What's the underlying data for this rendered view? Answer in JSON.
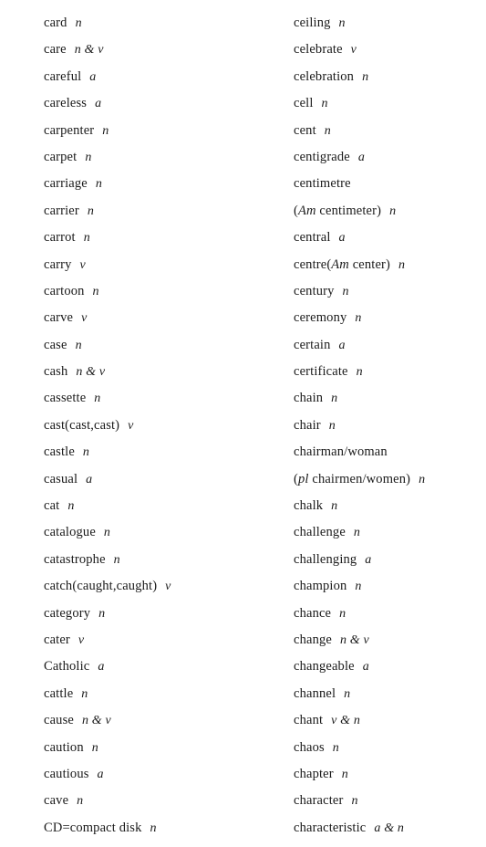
{
  "document": {
    "type": "vocabulary-word-list",
    "background_color": "#ffffff",
    "text_color": "#1a1a1a",
    "columns": 2,
    "line_count_per_column": 31
  },
  "left_column": {
    "name": "left-word-column",
    "entries": [
      {
        "word": "card",
        "pos": "n"
      },
      {
        "word": "care",
        "pos": "n & v"
      },
      {
        "word": "careful",
        "pos": "a"
      },
      {
        "word": "careless",
        "pos": "a"
      },
      {
        "word": "carpenter",
        "pos": "n"
      },
      {
        "word": "carpet",
        "pos": "n"
      },
      {
        "word": "carriage",
        "pos": "n"
      },
      {
        "word": "carrier",
        "pos": "n"
      },
      {
        "word": "carrot",
        "pos": "n"
      },
      {
        "word": "carry",
        "pos": "v"
      },
      {
        "word": "cartoon",
        "pos": "n"
      },
      {
        "word": "carve",
        "pos": "v"
      },
      {
        "word": "case",
        "pos": "n"
      },
      {
        "word": "cash",
        "pos": "n & v"
      },
      {
        "word": "cassette",
        "pos": "n"
      },
      {
        "word": "cast(cast,cast)",
        "pos": "v"
      },
      {
        "word": "castle",
        "pos": "n"
      },
      {
        "word": "casual",
        "pos": "a"
      },
      {
        "word": "cat",
        "pos": "n"
      },
      {
        "word": "catalogue",
        "pos": "n"
      },
      {
        "word": "catastrophe",
        "pos": "n"
      },
      {
        "word": "catch(caught,caught)",
        "pos": "v"
      },
      {
        "word": "category",
        "pos": "n"
      },
      {
        "word": "cater",
        "pos": "v"
      },
      {
        "word": "Catholic",
        "pos": "a"
      },
      {
        "word": "cattle",
        "pos": "n"
      },
      {
        "word": "cause",
        "pos": "n & v"
      },
      {
        "word": "caution",
        "pos": "n"
      },
      {
        "word": "cautious",
        "pos": "a"
      },
      {
        "word": "cave",
        "pos": "n"
      },
      {
        "word": "CD=compact disk",
        "pos": "n"
      }
    ]
  },
  "right_column": {
    "name": "right-word-column",
    "entries": [
      {
        "word": "ceiling",
        "pos": "n"
      },
      {
        "word": "celebrate",
        "pos": "v"
      },
      {
        "word": "celebration",
        "pos": "n"
      },
      {
        "word": "cell",
        "pos": "n"
      },
      {
        "word": "cent",
        "pos": "n"
      },
      {
        "word": "centigrade",
        "pos": "a"
      },
      {
        "word": "centimetre",
        "pos": ""
      },
      {
        "word": "(",
        "italic": "Am",
        "word_after": " centimeter)",
        "pos": "n",
        "continuation": true
      },
      {
        "word": "central",
        "pos": "a"
      },
      {
        "word": "centre(",
        "italic": "Am",
        "word_after": " center)",
        "pos": "n"
      },
      {
        "word": "century",
        "pos": "n"
      },
      {
        "word": "ceremony",
        "pos": "n"
      },
      {
        "word": "certain",
        "pos": "a"
      },
      {
        "word": "certificate",
        "pos": "n"
      },
      {
        "word": "chain",
        "pos": "n"
      },
      {
        "word": "chair",
        "pos": "n"
      },
      {
        "word": "chairman/woman",
        "pos": ""
      },
      {
        "word": "(",
        "italic": "pl",
        "word_after": " chairmen/women)",
        "pos": "n",
        "continuation": true
      },
      {
        "word": "chalk",
        "pos": "n"
      },
      {
        "word": "challenge",
        "pos": "n"
      },
      {
        "word": "challenging",
        "pos": "a"
      },
      {
        "word": "champion",
        "pos": "n"
      },
      {
        "word": "chance",
        "pos": "n"
      },
      {
        "word": "change",
        "pos": "n & v"
      },
      {
        "word": "changeable",
        "pos": "a"
      },
      {
        "word": "channel",
        "pos": "n"
      },
      {
        "word": "chant",
        "pos": "v & n"
      },
      {
        "word": "chaos",
        "pos": "n"
      },
      {
        "word": "chapter",
        "pos": "n"
      },
      {
        "word": "character",
        "pos": "n"
      },
      {
        "word": "characteristic",
        "pos": "a & n"
      }
    ]
  }
}
